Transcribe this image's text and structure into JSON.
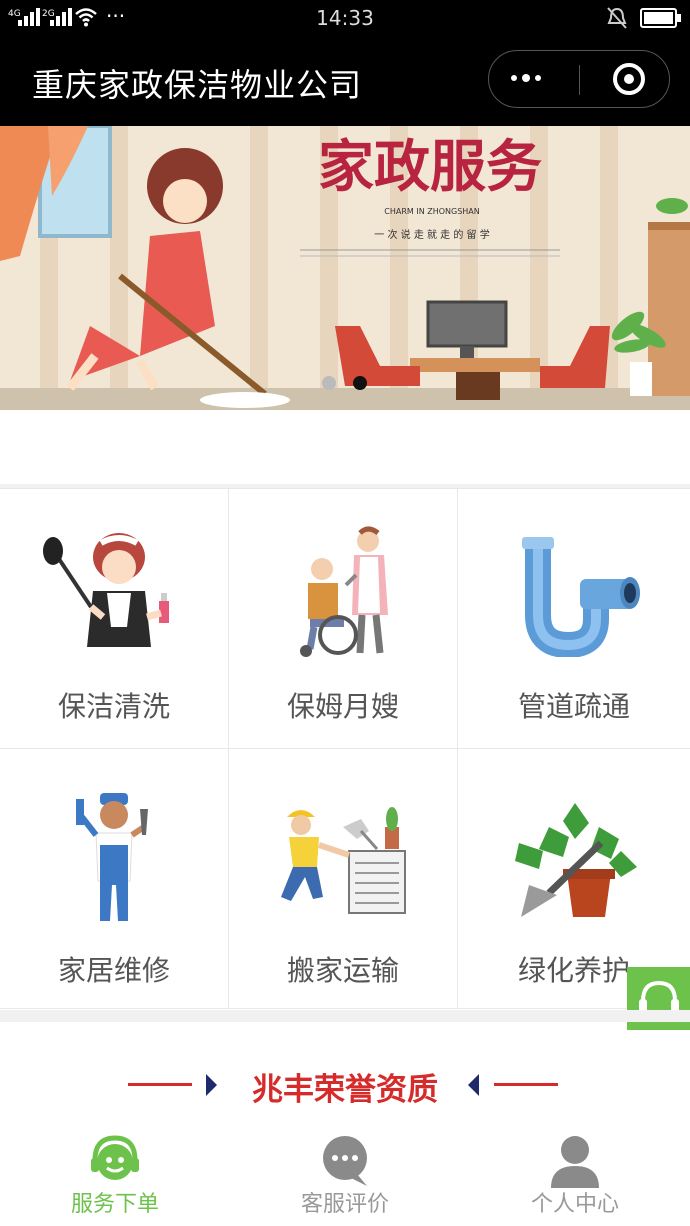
{
  "status_bar": {
    "time": "14:33",
    "signal_1": "4G",
    "signal_2": "2G",
    "more": "···"
  },
  "navbar": {
    "title": "重庆家政保洁物业公司"
  },
  "banner": {
    "headline": "家政服务",
    "subtitle_en": "CHARM IN ZHONGSHAN",
    "subtitle_cn": "一 次 说 走 就 走 的 留 学",
    "active_slide": 2,
    "slide_count": 2
  },
  "services": [
    {
      "label": "保洁清洗",
      "icon": "maid-cleaning-icon"
    },
    {
      "label": "保姆月嫂",
      "icon": "caregiver-wheelchair-icon"
    },
    {
      "label": "管道疏通",
      "icon": "pipe-icon"
    },
    {
      "label": "家居维修",
      "icon": "repairman-icon"
    },
    {
      "label": "搬家运输",
      "icon": "moving-worker-icon"
    },
    {
      "label": "绿化养护",
      "icon": "plant-shovel-icon"
    }
  ],
  "section": {
    "title": "兆丰荣誉资质"
  },
  "tabbar": {
    "items": [
      {
        "label": "服务下单",
        "icon": "service-order-icon",
        "active": true
      },
      {
        "label": "客服评价",
        "icon": "chat-bubble-icon",
        "active": false
      },
      {
        "label": "个人中心",
        "icon": "user-icon",
        "active": false
      }
    ]
  },
  "colors": {
    "accent_green": "#6cc24a",
    "section_red": "#d62b2b",
    "arrow_navy": "#1f2a6b",
    "tab_inactive": "#999999"
  }
}
